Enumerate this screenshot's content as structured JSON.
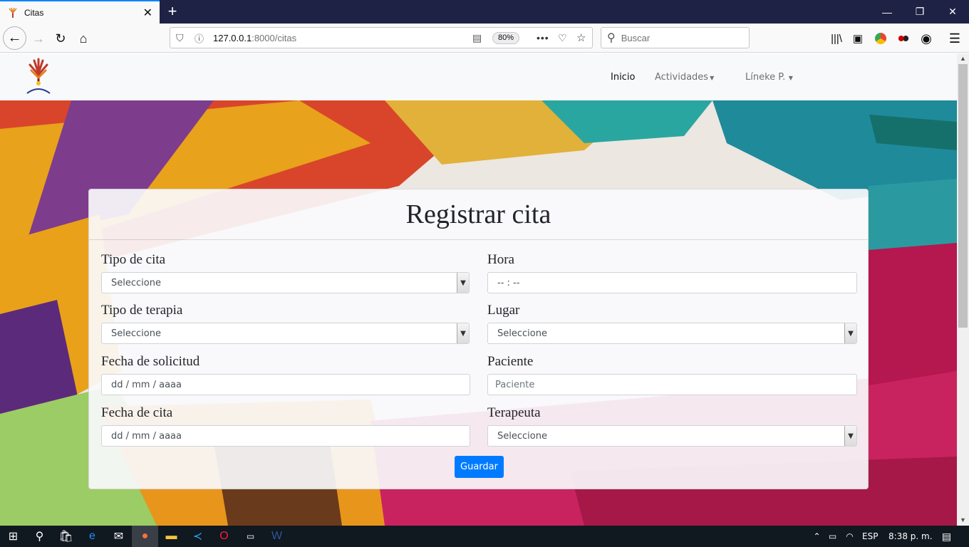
{
  "browser": {
    "tab_title": "Citas",
    "url_host": "127.0.0.1",
    "url_path": ":8000/citas",
    "zoom": "80%",
    "search_placeholder": "Buscar",
    "accent": "#0a84ff"
  },
  "site_nav": {
    "items": [
      {
        "label": "Inicio"
      },
      {
        "label": "Actividades"
      },
      {
        "label": "Líneke P."
      }
    ]
  },
  "form": {
    "title": "Registrar cita",
    "fields": {
      "tipo_cita": {
        "label": "Tipo de cita",
        "value": "Seleccione"
      },
      "hora": {
        "label": "Hora",
        "value": "-- : --"
      },
      "tipo_terapia": {
        "label": "Tipo de terapia",
        "value": "Seleccione"
      },
      "lugar": {
        "label": "Lugar",
        "value": "Seleccione"
      },
      "fecha_solicitud": {
        "label": "Fecha de solicitud",
        "value": "dd / mm / aaaa"
      },
      "paciente": {
        "label": "Paciente",
        "placeholder": "Paciente"
      },
      "fecha_cita": {
        "label": "Fecha de cita",
        "value": "dd / mm / aaaa"
      },
      "terapeuta": {
        "label": "Terapeuta",
        "value": "Seleccione"
      }
    },
    "submit_label": "Guardar",
    "submit_color": "#007bff"
  },
  "taskbar": {
    "language": "ESP",
    "time": "8:38 p. m."
  }
}
